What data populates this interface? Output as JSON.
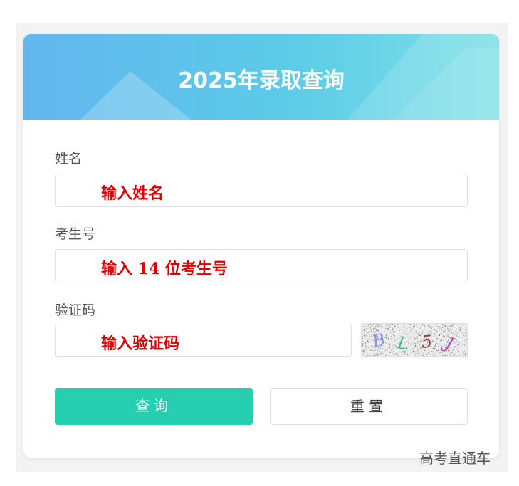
{
  "header": {
    "title": "2025年录取查询"
  },
  "form": {
    "name": {
      "label": "姓名",
      "placeholder": "输入姓名"
    },
    "exam_number": {
      "label": "考生号",
      "placeholder": "输入 14 位考生号"
    },
    "captcha": {
      "label": "验证码",
      "placeholder": "输入验证码",
      "image_text": "BL5J"
    }
  },
  "buttons": {
    "query_label": "查询",
    "reset_label": "重置"
  },
  "watermark": "高考直通车",
  "colors": {
    "banner_start": "#62b6ef",
    "banner_end": "#7ce0e6",
    "query_button": "#26cfb0",
    "placeholder_text": "#e00000"
  }
}
